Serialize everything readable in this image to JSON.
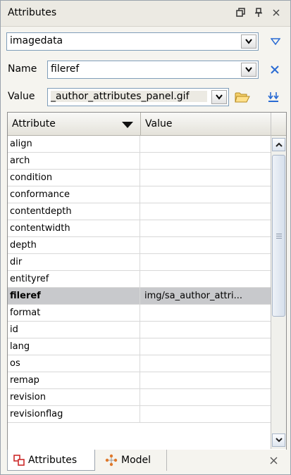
{
  "panel": {
    "title": "Attributes"
  },
  "element_combo": {
    "value": "imagedata"
  },
  "name_field": {
    "label": "Name",
    "value": "fileref"
  },
  "value_field": {
    "label": "Value",
    "value": "_author_attributes_panel.gif"
  },
  "table": {
    "headers": {
      "attribute": "Attribute",
      "value": "Value"
    },
    "rows": [
      {
        "name": "align",
        "value": ""
      },
      {
        "name": "arch",
        "value": ""
      },
      {
        "name": "condition",
        "value": ""
      },
      {
        "name": "conformance",
        "value": ""
      },
      {
        "name": "contentdepth",
        "value": ""
      },
      {
        "name": "contentwidth",
        "value": ""
      },
      {
        "name": "depth",
        "value": ""
      },
      {
        "name": "dir",
        "value": ""
      },
      {
        "name": "entityref",
        "value": ""
      },
      {
        "name": "fileref",
        "value": "img/sa_author_attri...",
        "selected": true
      },
      {
        "name": "format",
        "value": ""
      },
      {
        "name": "id",
        "value": ""
      },
      {
        "name": "lang",
        "value": ""
      },
      {
        "name": "os",
        "value": ""
      },
      {
        "name": "remap",
        "value": ""
      },
      {
        "name": "revision",
        "value": ""
      },
      {
        "name": "revisionflag",
        "value": ""
      }
    ]
  },
  "tabs": [
    {
      "label": "Attributes",
      "icon": "attributes-icon",
      "active": true
    },
    {
      "label": "Model",
      "icon": "model-tree-icon",
      "active": false
    }
  ],
  "icons": {
    "restore": "restore-window-icon",
    "pin": "pin-icon",
    "close": "close-icon",
    "filter": "filter-triangle-icon",
    "remove": "remove-x-icon",
    "browse": "open-folder-icon",
    "insert": "insert-value-icon"
  },
  "colors": {
    "accent": "#2a6bd3",
    "selected_row": "#c8c9cc",
    "tab_red": "#cc2a2a",
    "model_orange": "#e0782a"
  }
}
